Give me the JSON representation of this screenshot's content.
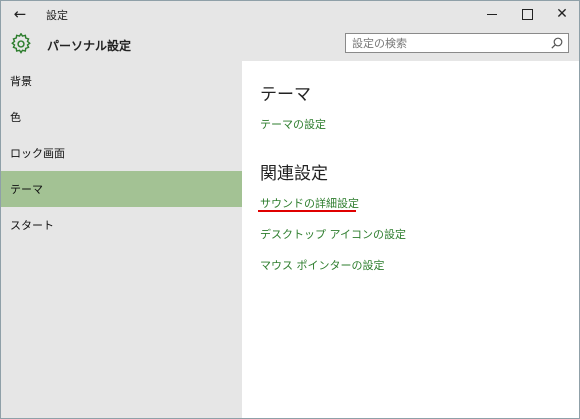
{
  "titlebar": {
    "app_title": "設定"
  },
  "header": {
    "title": "パーソナル設定",
    "search_placeholder": "設定の検索"
  },
  "sidebar": {
    "items": [
      {
        "label": "背景"
      },
      {
        "label": "色"
      },
      {
        "label": "ロック画面"
      },
      {
        "label": "テーマ"
      },
      {
        "label": "スタート"
      }
    ],
    "active_index": 3
  },
  "main": {
    "theme_heading": "テーマ",
    "theme_settings_link": "テーマの設定",
    "related_heading": "関連設定",
    "related_links": [
      "サウンドの詳細設定",
      "デスクトップ アイコンの設定",
      "マウス ポインターの設定"
    ]
  },
  "icons": {
    "back": "back-arrow-icon",
    "gear": "gear-icon",
    "search": "search-icon"
  },
  "colors": {
    "accent_green": "#2d7d2d",
    "active_item_bg": "#a3c294",
    "chrome_gray": "#e6e6e6",
    "annotation_red": "#e00000"
  }
}
